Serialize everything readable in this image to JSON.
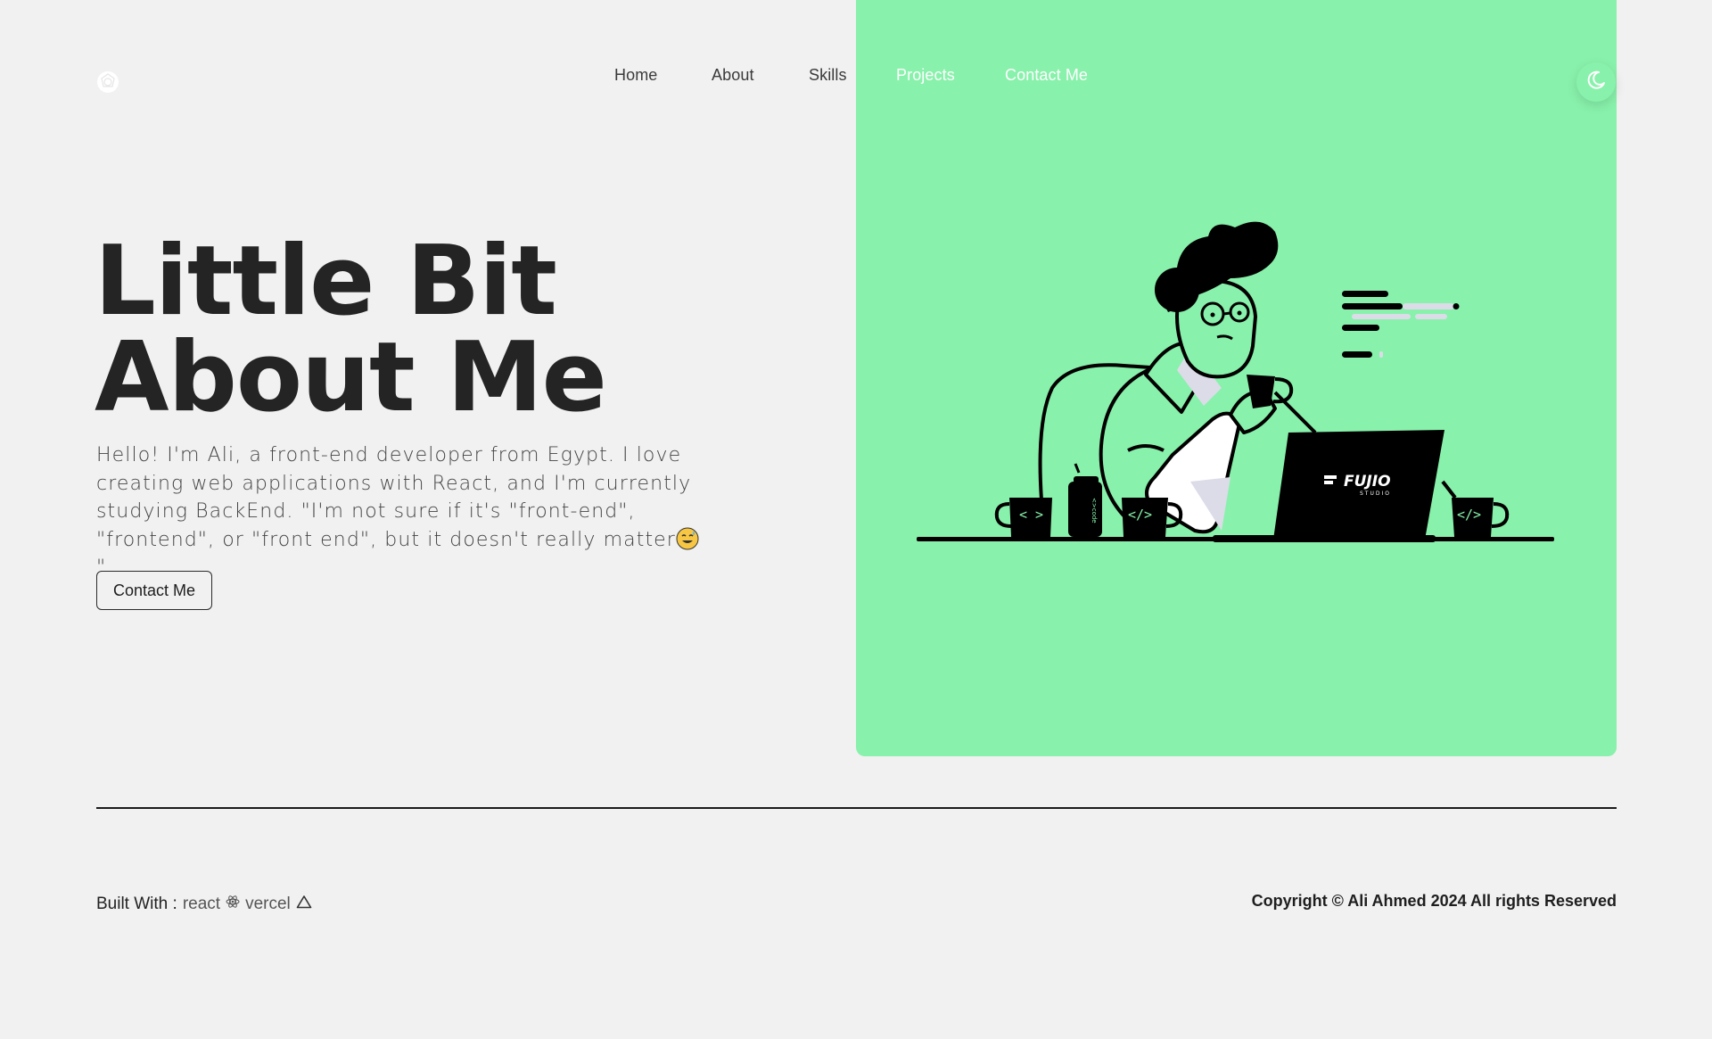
{
  "nav": {
    "items": [
      {
        "label": "Home"
      },
      {
        "label": "About"
      },
      {
        "label": "Skills"
      },
      {
        "label": "Projects"
      },
      {
        "label": "Contact Me"
      }
    ]
  },
  "icons": {
    "logo": "logo-icon",
    "theme_toggle": "moon-icon",
    "react": "react-icon",
    "vercel": "vercel-triangle-icon"
  },
  "hero": {
    "title_line1": "Little Bit",
    "title_line2": "About Me",
    "description": "Hello! I'm Ali, a front-end developer from Egypt. I love creating web applications with React, and I'm currently studying BackEnd. \"I'm not sure if it's \"front-end\", \"frontend\", or \"front end\", but it doesn't really matter",
    "description_end": "\"",
    "contact_button": "Contact Me"
  },
  "illustration": {
    "laptop_brand": "FUJIO",
    "laptop_sub": "STUDIO",
    "mug_left": "< >",
    "mug_mid": "</>",
    "mug_right": "</>"
  },
  "footer": {
    "built_with_label": "Built With :",
    "tech1": "react",
    "tech2": "vercel",
    "copyright": "Copyright © Ali Ahmed 2024 All rights Reserved"
  },
  "colors": {
    "background": "#f1f1f1",
    "accent_green": "#88f1ab",
    "text_dark": "#242424"
  }
}
